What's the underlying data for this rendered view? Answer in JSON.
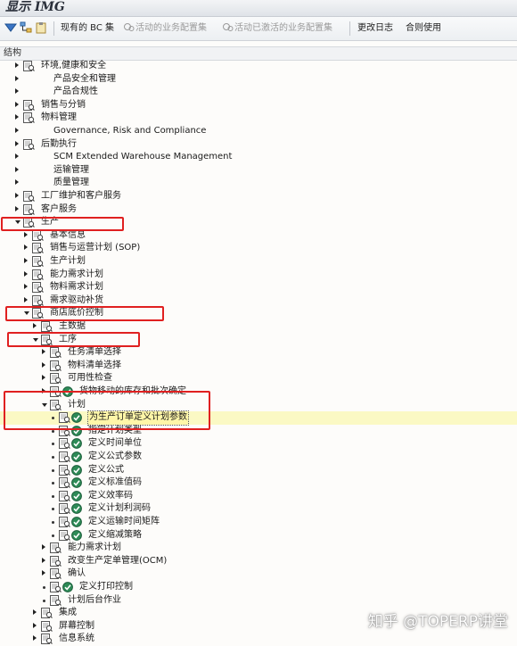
{
  "window": {
    "title": "显示 IMG"
  },
  "toolbar": {
    "existing_bc_sets": "现有的 BC 集",
    "activated_bc_sets": "活动的业务配置集",
    "changelog_bc_sets": "活动已激活的业务配置集",
    "change_log": "更改日志",
    "where_used": "合则使用"
  },
  "tree_header": "结构",
  "tree": [
    {
      "label": "环境,健康和安全",
      "level": 0,
      "expander": "closed",
      "doc": true,
      "exec": false
    },
    {
      "label": "产品安全和管理",
      "level": 0,
      "expander": "closed",
      "doc": false,
      "exec": false
    },
    {
      "label": "产品合规性",
      "level": 0,
      "expander": "closed",
      "doc": false,
      "exec": false
    },
    {
      "label": "销售与分销",
      "level": 0,
      "expander": "closed",
      "doc": true,
      "exec": false
    },
    {
      "label": "物料管理",
      "level": 0,
      "expander": "closed",
      "doc": true,
      "exec": false
    },
    {
      "label": "Governance, Risk and Compliance",
      "level": 0,
      "expander": "closed",
      "doc": false,
      "exec": false
    },
    {
      "label": "后勤执行",
      "level": 0,
      "expander": "closed",
      "doc": true,
      "exec": false
    },
    {
      "label": "SCM Extended Warehouse Management",
      "level": 0,
      "expander": "closed",
      "doc": false,
      "exec": false
    },
    {
      "label": "运输管理",
      "level": 0,
      "expander": "closed",
      "doc": false,
      "exec": false
    },
    {
      "label": "质量管理",
      "level": 0,
      "expander": "closed",
      "doc": false,
      "exec": false
    },
    {
      "label": "工厂维护和客户服务",
      "level": 0,
      "expander": "closed",
      "doc": true,
      "exec": false
    },
    {
      "label": "客户服务",
      "level": 0,
      "expander": "closed",
      "doc": true,
      "exec": false
    },
    {
      "label": "生产",
      "level": 0,
      "expander": "open",
      "doc": true,
      "exec": false
    },
    {
      "label": "基本信息",
      "level": 1,
      "expander": "closed",
      "doc": true,
      "exec": false
    },
    {
      "label": "销售与运营计划 (SOP)",
      "level": 1,
      "expander": "closed",
      "doc": true,
      "exec": false
    },
    {
      "label": "生产计划",
      "level": 1,
      "expander": "closed",
      "doc": true,
      "exec": false
    },
    {
      "label": "能力需求计划",
      "level": 1,
      "expander": "closed",
      "doc": true,
      "exec": false
    },
    {
      "label": "物料需求计划",
      "level": 1,
      "expander": "closed",
      "doc": true,
      "exec": false
    },
    {
      "label": "需求驱动补货",
      "level": 1,
      "expander": "closed",
      "doc": true,
      "exec": false
    },
    {
      "label": "商店底价控制",
      "level": 1,
      "expander": "open",
      "doc": true,
      "exec": false
    },
    {
      "label": "主数据",
      "level": 2,
      "expander": "closed",
      "doc": true,
      "exec": false
    },
    {
      "label": "工序",
      "level": 2,
      "expander": "open",
      "doc": true,
      "exec": false
    },
    {
      "label": "任务清单选择",
      "level": 3,
      "expander": "closed",
      "doc": true,
      "exec": false
    },
    {
      "label": "物料清单选择",
      "level": 3,
      "expander": "closed",
      "doc": true,
      "exec": false
    },
    {
      "label": "可用性检查",
      "level": 3,
      "expander": "closed",
      "doc": true,
      "exec": false
    },
    {
      "label": "货物移动的库存和批次确定",
      "level": 3,
      "expander": "closed",
      "doc": true,
      "exec": true
    },
    {
      "label": "计划",
      "level": 3,
      "expander": "open",
      "doc": true,
      "exec": false
    },
    {
      "label": "为生产订单定义计划参数",
      "level": 4,
      "expander": "leaf",
      "doc": true,
      "exec": true,
      "selected": true
    },
    {
      "label": "指定计划类型",
      "level": 4,
      "expander": "leaf",
      "doc": true,
      "exec": true
    },
    {
      "label": "定义时间单位",
      "level": 4,
      "expander": "leaf",
      "doc": true,
      "exec": true
    },
    {
      "label": "定义公式参数",
      "level": 4,
      "expander": "leaf",
      "doc": true,
      "exec": true
    },
    {
      "label": "定义公式",
      "level": 4,
      "expander": "leaf",
      "doc": true,
      "exec": true
    },
    {
      "label": "定义标准值码",
      "level": 4,
      "expander": "leaf",
      "doc": true,
      "exec": true
    },
    {
      "label": "定义效率码",
      "level": 4,
      "expander": "leaf",
      "doc": true,
      "exec": true
    },
    {
      "label": "定义计划利润码",
      "level": 4,
      "expander": "leaf",
      "doc": true,
      "exec": true
    },
    {
      "label": "定义运输时间矩阵",
      "level": 4,
      "expander": "leaf",
      "doc": true,
      "exec": true
    },
    {
      "label": "定义缩减策略",
      "level": 4,
      "expander": "leaf",
      "doc": true,
      "exec": true
    },
    {
      "label": "能力需求计划",
      "level": 3,
      "expander": "closed",
      "doc": true,
      "exec": false
    },
    {
      "label": "改变生产定单管理(OCM)",
      "level": 3,
      "expander": "closed",
      "doc": true,
      "exec": false
    },
    {
      "label": "确认",
      "level": 3,
      "expander": "closed",
      "doc": true,
      "exec": false
    },
    {
      "label": "定义打印控制",
      "level": 3,
      "expander": "leaf",
      "doc": true,
      "exec": true
    },
    {
      "label": "计划后台作业",
      "level": 3,
      "expander": "leaf",
      "doc": true,
      "exec": false
    },
    {
      "label": "集成",
      "level": 2,
      "expander": "closed",
      "doc": true,
      "exec": false
    },
    {
      "label": "屏幕控制",
      "level": 2,
      "expander": "closed",
      "doc": true,
      "exec": false
    },
    {
      "label": "信息系统",
      "level": 2,
      "expander": "closed",
      "doc": true,
      "exec": false
    }
  ],
  "watermark": "知乎 @TOPERP讲堂",
  "colors": {
    "highlight": "#fbf9c4",
    "annotation_box": "#e02020",
    "exec_icon": "#2e8b57"
  }
}
